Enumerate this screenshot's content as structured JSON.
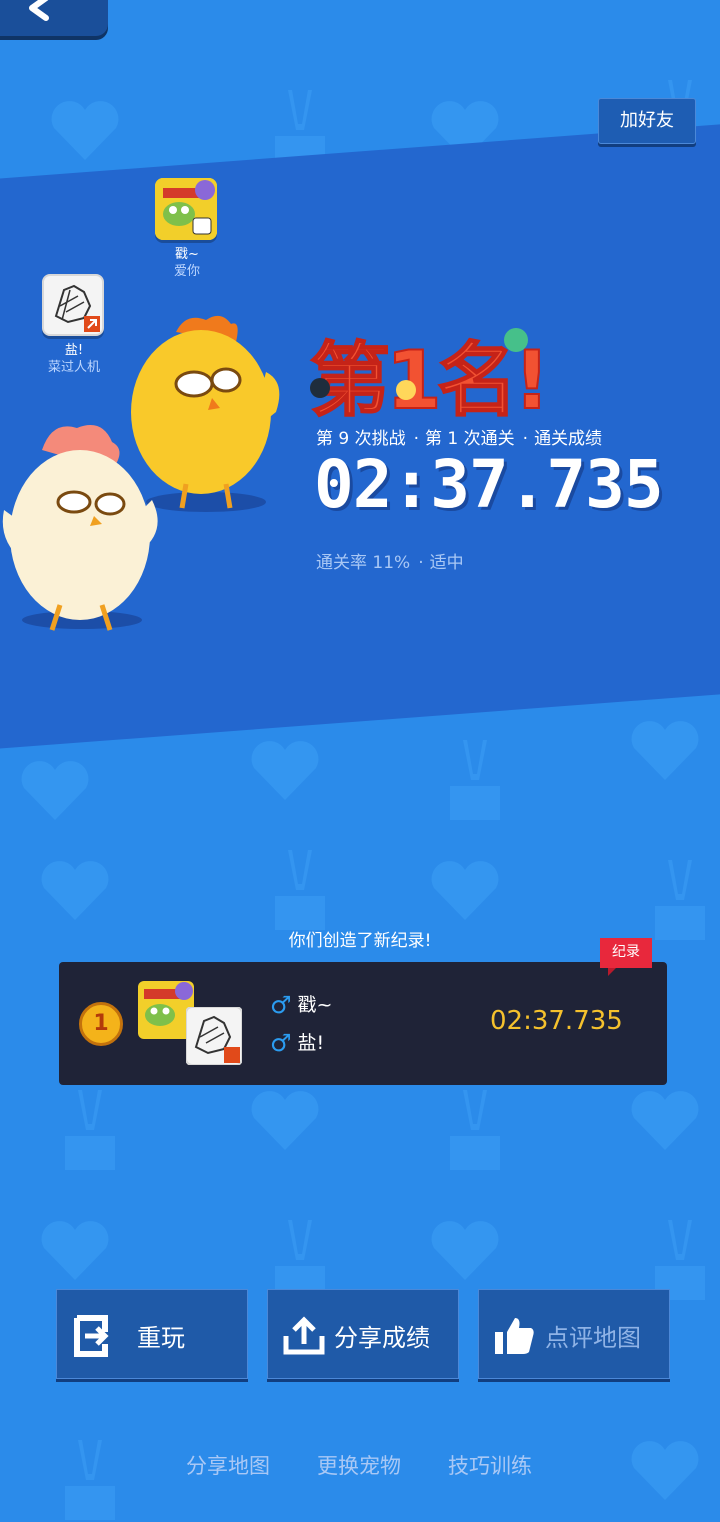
{
  "header": {
    "add_friend_label": "加好友"
  },
  "players": [
    {
      "name": "戳~",
      "subtitle": "爱你"
    },
    {
      "name": "盐!",
      "subtitle": "菜过人机"
    }
  ],
  "result": {
    "rank_title": "第1名!",
    "stats": [
      "第 9 次挑战",
      "第 1 次通关",
      "通关成绩"
    ],
    "time": "02:37.735",
    "pass_rate": "通关率 11%",
    "difficulty": "适中"
  },
  "record": {
    "new_record_label": "你们创造了新纪录!",
    "tag": "纪录",
    "rank": "1",
    "names": [
      "戳~",
      "盐!"
    ],
    "time": "02:37.735"
  },
  "actions": [
    {
      "label": "重玩",
      "icon": "replay-icon"
    },
    {
      "label": "分享成绩",
      "icon": "share-icon"
    },
    {
      "label": "点评地图",
      "icon": "thumbs-up-icon"
    }
  ],
  "bottom_links": [
    "分享地图",
    "更换宠物",
    "技巧训练"
  ],
  "colors": {
    "background": "#2b8bea",
    "band": "#2367cf",
    "card": "#1f2337",
    "gold": "#f5c12d",
    "record_tag": "#e8283c",
    "male": "#2b9cf0"
  }
}
